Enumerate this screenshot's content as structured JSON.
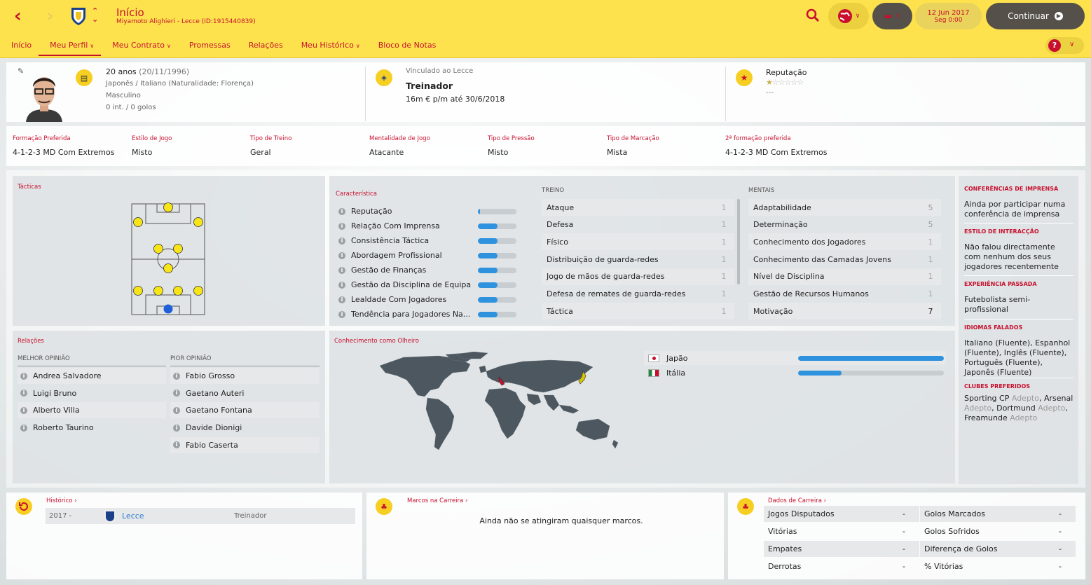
{
  "header": {
    "title": "Início",
    "subtitle": "Miyamoto Alighieri - Lecce (ID:1915440839)",
    "date": "12 Jun 2017",
    "time": "Seg 0:00",
    "continue_label": "Continuar"
  },
  "tabs": [
    {
      "label": "Início"
    },
    {
      "label": "Meu Perfil",
      "active": true,
      "dropdown": true
    },
    {
      "label": "Meu Contrato",
      "dropdown": true
    },
    {
      "label": "Promessas"
    },
    {
      "label": "Relações"
    },
    {
      "label": "Meu Histórico",
      "dropdown": true
    },
    {
      "label": "Bloco de Notas"
    }
  ],
  "profile": {
    "age": "20 anos",
    "dob": "(20/11/1996)",
    "nationality": "Japonês / Italiano (Naturalidade: Florença)",
    "gender": "Masculino",
    "caps": "0 int. / 0 golos",
    "club_link": "Vinculado ao Lecce",
    "role": "Treinador",
    "contract": "16m € p/m até 30/6/2018",
    "reputation_label": "Reputação",
    "reputation_stars": 0.5,
    "reputation_sub": "---"
  },
  "preferences": [
    {
      "label": "Formação Preferida",
      "value": "4-1-2-3 MD Com Extremos"
    },
    {
      "label": "Estilo de Jogo",
      "value": "Misto"
    },
    {
      "label": "Tipo de Treino",
      "value": "Geral"
    },
    {
      "label": "Mentalidade de Jogo",
      "value": "Atacante"
    },
    {
      "label": "Tipo de Pressão",
      "value": "Misto"
    },
    {
      "label": "Tipo de Marcação",
      "value": "Mista"
    },
    {
      "label": "2ª formação preferida",
      "value": "4-1-2-3 MD Com Extremos"
    }
  ],
  "tactics": {
    "title": "Tácticas"
  },
  "characteristics": {
    "title": "Característica",
    "items": [
      {
        "label": "Reputação",
        "level": 0.05
      },
      {
        "label": "Relação Com Imprensa",
        "level": 0.5
      },
      {
        "label": "Consistência Táctica",
        "level": 0.5
      },
      {
        "label": "Abordagem Profissional",
        "level": 0.5
      },
      {
        "label": "Gestão de Finanças",
        "level": 0.5
      },
      {
        "label": "Gestão da Disciplina de Equipa",
        "level": 0.5
      },
      {
        "label": "Lealdade Com Jogadores",
        "level": 0.5
      },
      {
        "label": "Tendência para Jogadores Na...",
        "level": 0.5
      }
    ]
  },
  "training": {
    "title": "TREINO",
    "items": [
      {
        "label": "Ataque",
        "value": "1"
      },
      {
        "label": "Defesa",
        "value": "1"
      },
      {
        "label": "Físico",
        "value": "1"
      },
      {
        "label": "Distribuição de guarda-redes",
        "value": "1"
      },
      {
        "label": "Jogo de mãos de guarda-redes",
        "value": "1"
      },
      {
        "label": "Defesa de remates de guarda-redes",
        "value": "1"
      },
      {
        "label": "Táctica",
        "value": "1"
      }
    ]
  },
  "mental": {
    "title": "MENTAIS",
    "items": [
      {
        "label": "Adaptabilidade",
        "value": "5"
      },
      {
        "label": "Determinação",
        "value": "5"
      },
      {
        "label": "Conhecimento dos Jogadores",
        "value": "1"
      },
      {
        "label": "Conhecimento das Camadas Jovens",
        "value": "1"
      },
      {
        "label": "Nível de Disciplina",
        "value": "1"
      },
      {
        "label": "Gestão de Recursos Humanos",
        "value": "1"
      },
      {
        "label": "Motivação",
        "value": "7"
      }
    ]
  },
  "relations": {
    "title": "Relações",
    "best_label": "MELHOR OPINIÃO",
    "worst_label": "PIOR OPINIÃO",
    "best": [
      "Andrea Salvadore",
      "Luigi Bruno",
      "Alberto Villa",
      "Roberto Taurino"
    ],
    "worst": [
      "Fabio Grosso",
      "Gaetano Auteri",
      "Gaetano Fontana",
      "Davide Dionigi",
      "Fabio Caserta"
    ]
  },
  "scout": {
    "title": "Conhecimento como Olheiro",
    "countries": [
      {
        "name": "Japão",
        "level": 1.0
      },
      {
        "name": "Itália",
        "level": 0.3
      }
    ]
  },
  "sidebar": {
    "sections": [
      {
        "title": "CONFERÊNCIAS DE IMPRENSA",
        "text": "Ainda por participar numa conferência de imprensa"
      },
      {
        "title": "ESTILO DE INTERACÇÃO",
        "text": "Não falou directamente com nenhum dos seus jogadores recentemente"
      },
      {
        "title": "EXPERIÊNCIA PASSADA",
        "text": "Futebolista semi-profissional"
      },
      {
        "title": "IDIOMAS FALADOS",
        "text": "Italiano (Fluente), Espanhol (Fluente), Inglês (Fluente), Português (Fluente), Japonês (Fluente)"
      }
    ],
    "clubs_title": "CLUBES PREFERIDOS",
    "clubs": [
      {
        "name": "Sporting CP",
        "tag": "Adepto"
      },
      {
        "name": "Arsenal",
        "tag": "Adepto"
      },
      {
        "name": "Dortmund",
        "tag": "Adepto"
      },
      {
        "name": "Freamunde",
        "tag": "Adepto"
      }
    ]
  },
  "history": {
    "title": "Histórico",
    "rows": [
      {
        "period": "2017 -",
        "club": "Lecce",
        "role": "Treinador"
      }
    ]
  },
  "milestones": {
    "title": "Marcos na Carreira",
    "empty": "Ainda não se atingiram quaisquer marcos."
  },
  "career": {
    "title": "Dados de Carreira",
    "left": [
      {
        "label": "Jogos Disputados",
        "value": "-"
      },
      {
        "label": "Vitórias",
        "value": "-"
      },
      {
        "label": "Empates",
        "value": "-"
      },
      {
        "label": "Derrotas",
        "value": "-"
      }
    ],
    "right": [
      {
        "label": "Golos Marcados",
        "value": "-"
      },
      {
        "label": "Golos Sofridos",
        "value": "-"
      },
      {
        "label": "Diferença de Golos",
        "value": "-"
      },
      {
        "label": "% Vitórias",
        "value": "-"
      }
    ]
  },
  "colors": {
    "accent": "#c8102e",
    "header": "#fde24e",
    "bar": "#2f92de",
    "player": "#f7e51a",
    "keeper": "#1f5fd8"
  },
  "icons": {
    "back": "back-arrow-icon",
    "forward": "forward-arrow-icon",
    "search": "search-icon",
    "help": "help-icon"
  }
}
